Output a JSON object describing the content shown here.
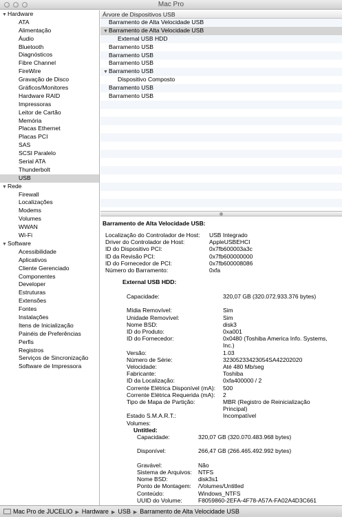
{
  "window": {
    "title": "Mac Pro"
  },
  "sidebar": {
    "sections": [
      {
        "label": "Hardware",
        "items": [
          "ATA",
          "Alimentação",
          "Áudio",
          "Bluetooth",
          "Diagnósticos",
          "Fibre Channel",
          "FireWire",
          "Gravação de Disco",
          "Gráficos/Monitores",
          "Hardware RAID",
          "Impressoras",
          "Leitor de Cartão",
          "Memória",
          "Placas Ethernet",
          "Placas PCI",
          "SAS",
          "SCSI Paralelo",
          "Serial ATA",
          "Thunderbolt",
          "USB"
        ]
      },
      {
        "label": "Rede",
        "items": [
          "Firewall",
          "Localizações",
          "Modems",
          "Volumes",
          "WWAN",
          "Wi-Fi"
        ]
      },
      {
        "label": "Software",
        "items": [
          "Acessibilidade",
          "Aplicativos",
          "Cliente Gerenciado",
          "Componentes",
          "Developer",
          "Estruturas",
          "Extensões",
          "Fontes",
          "Instalações",
          "Itens de Inicialização",
          "Painéis de Preferências",
          "Perfis",
          "Registros",
          "Serviços de Sincronização",
          "Software de Impressora"
        ]
      }
    ],
    "selected": "USB"
  },
  "tree": {
    "header": "Árvore de Dispositivos USB",
    "rows": [
      {
        "label": "Barramento de Alta Velocidade USB",
        "level": 0,
        "expandable": false,
        "selected": false
      },
      {
        "label": "Barramento de Alta Velocidade USB",
        "level": 0,
        "expandable": true,
        "selected": true
      },
      {
        "label": "External USB HDD",
        "level": 1,
        "expandable": false,
        "selected": false
      },
      {
        "label": "Barramento USB",
        "level": 0,
        "expandable": false,
        "selected": false
      },
      {
        "label": "Barramento USB",
        "level": 0,
        "expandable": false,
        "selected": false
      },
      {
        "label": "Barramento USB",
        "level": 0,
        "expandable": false,
        "selected": false
      },
      {
        "label": "Barramento USB",
        "level": 0,
        "expandable": true,
        "selected": false
      },
      {
        "label": "Dispositivo Composto",
        "level": 1,
        "expandable": false,
        "selected": false
      },
      {
        "label": "Barramento USB",
        "level": 0,
        "expandable": false,
        "selected": false
      },
      {
        "label": "Barramento USB",
        "level": 0,
        "expandable": false,
        "selected": false
      }
    ]
  },
  "detail": {
    "title": "Barramento de Alta Velocidade USB:",
    "bus": [
      {
        "k": "Localização do Controlador de Host:",
        "v": "USB Integrado"
      },
      {
        "k": "Driver do Controlador de Host:",
        "v": "AppleUSBEHCI"
      },
      {
        "k": "ID do Dispositivo PCI:",
        "v": "0x7fb600003a3c"
      },
      {
        "k": "ID da Revisão PCI:",
        "v": "0x7fb600000000"
      },
      {
        "k": "ID do Fornecedor de PCI:",
        "v": "0x7fb600008086"
      },
      {
        "k": "Número do Barramento:",
        "v": "0xfa"
      }
    ],
    "device_title": "External USB HDD:",
    "device": [
      {
        "k": "Capacidade:",
        "v": "320,07 GB (320.072.933.376 bytes)"
      },
      {
        "k": "Mídia Removível:",
        "v": "Sim"
      },
      {
        "k": "Unidade Removível:",
        "v": "Sim"
      },
      {
        "k": "Nome BSD:",
        "v": "disk3"
      },
      {
        "k": "ID do Produto:",
        "v": "0xa001"
      },
      {
        "k": "ID do Fornecedor:",
        "v": "0x0480  (Toshiba America Info. Systems, Inc.)"
      },
      {
        "k": "Versão:",
        "v": "1.03"
      },
      {
        "k": "Número de Série:",
        "v": "32305233423054SA42202020"
      },
      {
        "k": "Velocidade:",
        "v": "Até 480 Mb/seg"
      },
      {
        "k": "Fabricante:",
        "v": "Toshiba"
      },
      {
        "k": "ID da Localização:",
        "v": "0xfa400000 / 2"
      },
      {
        "k": "Corrente Elétrica Disponível (mA):",
        "v": "500"
      },
      {
        "k": "Corrente Elétrica Requerida (mA):",
        "v": "2"
      },
      {
        "k": "Tipo de Mapa de Partição:",
        "v": "MBR (Registro de Reinicialização Principal)"
      },
      {
        "k": "Estado S.M.A.R.T.:",
        "v": "Incompatível"
      },
      {
        "k": "Volumes:",
        "v": ""
      }
    ],
    "volume_title": "Untitled:",
    "volume": [
      {
        "k": "Capacidade:",
        "v": "320,07 GB (320.070.483.968 bytes)"
      },
      {
        "k": "Disponível:",
        "v": "266,47 GB (266.465.492.992 bytes)"
      },
      {
        "k": "Gravável:",
        "v": "Não"
      },
      {
        "k": "Sistema de Arquivos:",
        "v": "NTFS"
      },
      {
        "k": "Nome BSD:",
        "v": "disk3s1"
      },
      {
        "k": "Ponto de Montagem:",
        "v": "/Volumes/Untitled"
      },
      {
        "k": "Conteúdo:",
        "v": "Windows_NTFS"
      },
      {
        "k": "UUID do Volume:",
        "v": "F8059860-2EFA-4F78-A57A-FA02A4D3C661"
      }
    ]
  },
  "pathbar": {
    "crumbs": [
      "Mac Pro de JUCELIO",
      "Hardware",
      "USB",
      "Barramento de Alta Velocidade USB"
    ]
  }
}
